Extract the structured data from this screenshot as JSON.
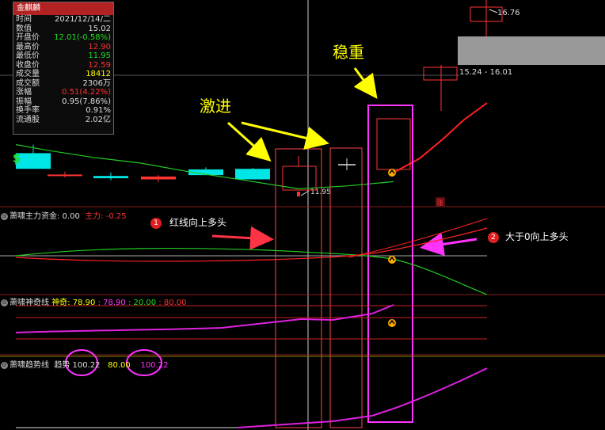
{
  "info_panel": {
    "title": "金麒麟",
    "rows": [
      {
        "k": "时间",
        "v": "2021/12/14/二",
        "color": "#dddddd"
      },
      {
        "k": "数值",
        "v": "15.02",
        "color": "#dddddd"
      },
      {
        "k": "开盘价",
        "v": "12.01(-0.58%)",
        "color": "#22dd22"
      },
      {
        "k": "最高价",
        "v": "12.90",
        "color": "#ff3333"
      },
      {
        "k": "最低价",
        "v": "11.95",
        "color": "#22dd22"
      },
      {
        "k": "收盘价",
        "v": "12.59",
        "color": "#ff3333"
      },
      {
        "k": "成交量",
        "v": "18412",
        "color": "#ffff00"
      },
      {
        "k": "成交额",
        "v": "2306万",
        "color": "#dddddd"
      },
      {
        "k": "涨幅",
        "v": "0.51(4.22%)",
        "color": "#ff3333"
      },
      {
        "k": "振幅",
        "v": "0.95(7.86%)",
        "color": "#dddddd"
      },
      {
        "k": "换手率",
        "v": "0.91%",
        "color": "#dddddd"
      },
      {
        "k": "流通股",
        "v": "2.02亿",
        "color": "#dddddd"
      }
    ]
  },
  "price_labels": {
    "high": "16.76",
    "range": "15.24 - 16.01",
    "low_marker": "11.95",
    "s_marker": "S",
    "zhang_marker": "涨"
  },
  "annotations": {
    "aggressive": "激进",
    "steady": "稳重",
    "note1_num": "1",
    "note1": "红线向上多头",
    "note2_num": "2",
    "note2": "大于0向上多头"
  },
  "panels": {
    "money_flow": {
      "name": "萧啸主力资金",
      "value": ": 0.00",
      "series_label": "主力",
      "series_value": ": -0.25"
    },
    "magic": {
      "name": "萧啸神奇线",
      "label1": "神奇",
      "value1": ": 78.90",
      "value2": ": 78.90",
      "value3": ": 20.00",
      "value4": ": 80.00"
    },
    "trend": {
      "name": "萧啸趋势线",
      "label1": "趋势",
      "value1": "100.22",
      "value2": "80.00",
      "value3": "100.22"
    }
  },
  "chart_data": {
    "type": "candlestick",
    "candles": [
      {
        "o": 13.6,
        "h": 13.9,
        "l": 13.05,
        "c": 13.05,
        "dir": "down"
      },
      {
        "o": 12.85,
        "h": 12.95,
        "l": 12.75,
        "c": 12.85,
        "dir": "flat"
      },
      {
        "o": 12.8,
        "h": 12.92,
        "l": 12.65,
        "c": 12.72,
        "dir": "down"
      },
      {
        "o": 12.68,
        "h": 12.83,
        "l": 12.58,
        "c": 12.78,
        "dir": "up"
      },
      {
        "o": 13.03,
        "h": 13.1,
        "l": 12.83,
        "c": 12.83,
        "dir": "down"
      },
      {
        "o": 13.05,
        "h": 13.08,
        "l": 12.68,
        "c": 12.68,
        "dir": "down"
      },
      {
        "o": 12.01,
        "h": 12.9,
        "l": 11.95,
        "c": 12.59,
        "dir": "up"
      },
      {
        "o": 13.6,
        "h": 13.6,
        "l": 13.6,
        "c": 13.6,
        "dir": "flat"
      },
      {
        "o": 14.0,
        "h": 15.9,
        "l": 14.0,
        "c": 15.7,
        "dir": "up"
      },
      {
        "o": 15.24,
        "h": 16.01,
        "l": 15.24,
        "c": 16.01,
        "dir": "up"
      },
      {
        "o": 16.4,
        "h": 16.76,
        "l": 16.2,
        "c": 16.7,
        "dir": "up"
      }
    ],
    "ma": [
      13.9,
      13.7,
      13.45,
      13.25,
      12.95,
      12.7,
      12.35,
      12.45,
      12.6,
      12.85,
      13.7,
      14.6
    ],
    "colors": {
      "up": "#ff3333",
      "down": "#00e5e5",
      "ma": "#22cc22",
      "highlight": "#ff33ff"
    }
  }
}
